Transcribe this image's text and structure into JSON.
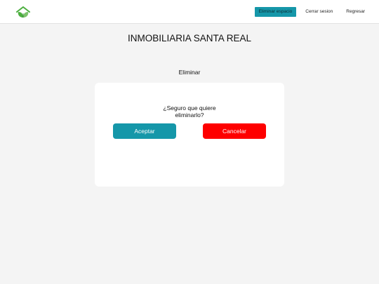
{
  "header": {
    "logo_icon": "house-leaf-icon",
    "nav": {
      "delete_space": "Eliminar espacio",
      "logout": "Cerrar sesion",
      "back": "Regresar"
    }
  },
  "main": {
    "title": "INMOBILIARIA SANTA REAL",
    "subtitle": "Eliminar"
  },
  "dialog": {
    "question": "¿Seguro que quiere eliminarlo?",
    "accept_label": "Aceptar",
    "cancel_label": "Cancelar"
  },
  "colors": {
    "accent": "#1597a9",
    "danger": "#fe0000",
    "logo_green": "#4caf3f"
  }
}
